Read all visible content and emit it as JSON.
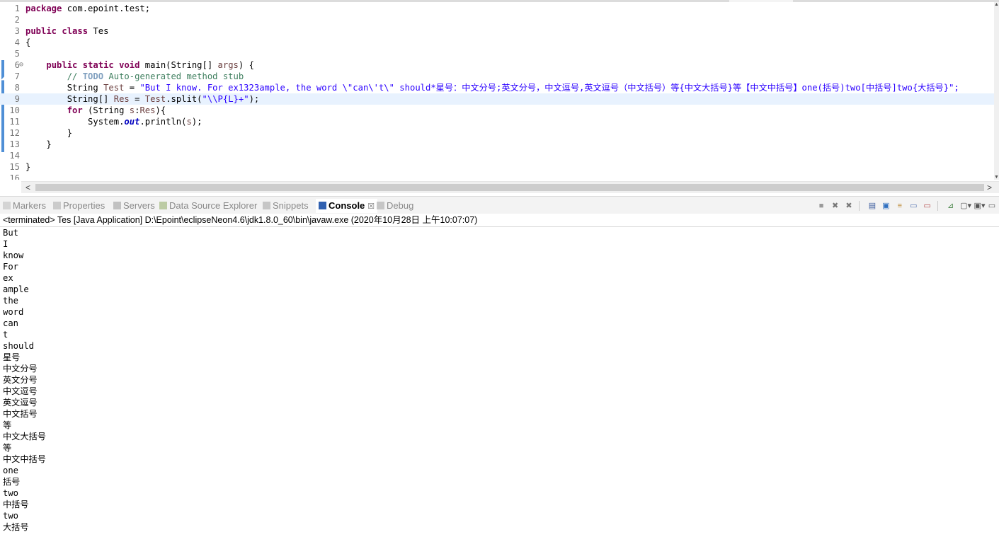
{
  "editor": {
    "lines": [
      {
        "n": "1",
        "segs": [
          {
            "t": "package",
            "c": "kw"
          },
          {
            "t": " com.epoint.test;",
            "c": ""
          }
        ]
      },
      {
        "n": "2",
        "segs": []
      },
      {
        "n": "3",
        "segs": [
          {
            "t": "public",
            "c": "kw"
          },
          {
            "t": " ",
            "c": ""
          },
          {
            "t": "class",
            "c": "kw"
          },
          {
            "t": " Tes",
            "c": ""
          }
        ]
      },
      {
        "n": "4",
        "segs": [
          {
            "t": "{",
            "c": ""
          }
        ]
      },
      {
        "n": "5",
        "segs": []
      },
      {
        "n": "6",
        "fold": "⊖",
        "segs": [
          {
            "t": "    ",
            "c": ""
          },
          {
            "t": "public",
            "c": "kw"
          },
          {
            "t": " ",
            "c": ""
          },
          {
            "t": "static",
            "c": "kw"
          },
          {
            "t": " ",
            "c": ""
          },
          {
            "t": "void",
            "c": "kw"
          },
          {
            "t": " main(String[] ",
            "c": ""
          },
          {
            "t": "args",
            "c": "var"
          },
          {
            "t": ") {",
            "c": ""
          }
        ]
      },
      {
        "n": "7",
        "warn": true,
        "segs": [
          {
            "t": "        // ",
            "c": "cmt"
          },
          {
            "t": "TODO",
            "c": "todo"
          },
          {
            "t": " Auto-generated method stub",
            "c": "cmt"
          }
        ]
      },
      {
        "n": "8",
        "segs": [
          {
            "t": "        String ",
            "c": ""
          },
          {
            "t": "Test",
            "c": "var"
          },
          {
            "t": " = ",
            "c": ""
          },
          {
            "t": "\"But I know. For ex1323ample, the word \\\"can\\'t\\\" should*星号：中文分号;英文分号，中文逗号,英文逗号（中文括号）等{中文大括号}等【中文中括号】one(括号)two[中括号]two{大括号}\";",
            "c": "str"
          }
        ]
      },
      {
        "n": "9",
        "current": true,
        "segs": [
          {
            "t": "        String[] ",
            "c": ""
          },
          {
            "t": "Res",
            "c": "var"
          },
          {
            "t": " = ",
            "c": ""
          },
          {
            "t": "Test",
            "c": "var"
          },
          {
            "t": ".split(",
            "c": ""
          },
          {
            "t": "\"\\\\P{L}+\"",
            "c": "str"
          },
          {
            "t": ");",
            "c": ""
          }
        ]
      },
      {
        "n": "10",
        "segs": [
          {
            "t": "        ",
            "c": ""
          },
          {
            "t": "for",
            "c": "kw"
          },
          {
            "t": " (String ",
            "c": ""
          },
          {
            "t": "s",
            "c": "var"
          },
          {
            "t": ":",
            "c": ""
          },
          {
            "t": "Res",
            "c": "var"
          },
          {
            "t": "){",
            "c": ""
          }
        ]
      },
      {
        "n": "11",
        "segs": [
          {
            "t": "            System.",
            "c": ""
          },
          {
            "t": "out",
            "c": "fld"
          },
          {
            "t": ".println(",
            "c": ""
          },
          {
            "t": "s",
            "c": "var"
          },
          {
            "t": ");",
            "c": ""
          }
        ]
      },
      {
        "n": "12",
        "segs": [
          {
            "t": "        }",
            "c": ""
          }
        ]
      },
      {
        "n": "13",
        "segs": [
          {
            "t": "    }",
            "c": ""
          }
        ]
      },
      {
        "n": "14",
        "segs": []
      },
      {
        "n": "15",
        "segs": [
          {
            "t": "}",
            "c": ""
          }
        ]
      },
      {
        "n": "16",
        "segs": []
      }
    ]
  },
  "views": {
    "tabs": [
      {
        "label": "Markers",
        "icon": "markers-icon",
        "color": "#c0c0c0",
        "active": false
      },
      {
        "label": "Properties",
        "icon": "properties-icon",
        "color": "#b0b0b0",
        "active": false
      },
      {
        "label": "Servers",
        "icon": "servers-icon",
        "color": "#a0a0a0",
        "active": false
      },
      {
        "label": "Data Source Explorer",
        "icon": "data-source-explorer-icon",
        "color": "#98b070",
        "active": false
      },
      {
        "label": "Snippets",
        "icon": "snippets-icon",
        "color": "#a8a8a8",
        "active": false
      },
      {
        "label": "Console",
        "icon": "console-icon",
        "color": "#3060b0",
        "active": true,
        "close": "☒"
      },
      {
        "label": "Debug",
        "icon": "debug-icon",
        "color": "#a8a8a8",
        "active": false
      }
    ]
  },
  "console": {
    "header": "<terminated> Tes [Java Application] D:\\Epoint\\eclipseNeon4.6\\jdk1.8.0_60\\bin\\javaw.exe (2020年10月28日 上午10:07:07)",
    "output": [
      "But",
      "I",
      "know",
      "For",
      "ex",
      "ample",
      "the",
      "word",
      "can",
      "t",
      "should",
      "星号",
      "中文分号",
      "英文分号",
      "中文逗号",
      "英文逗号",
      "中文括号",
      "等",
      "中文大括号",
      "等",
      "中文中括号",
      "one",
      "括号",
      "two",
      "中括号",
      "two",
      "大括号"
    ]
  }
}
